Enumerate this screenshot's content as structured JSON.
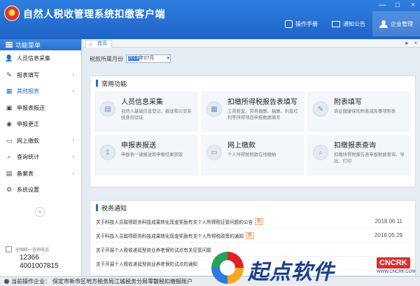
{
  "app": {
    "title": "自然人税收管理系统扣缴客户端",
    "window_controls": [
      "—",
      "□",
      "×"
    ]
  },
  "top_actions": [
    {
      "label": "操作手册",
      "icon": "manual-icon"
    },
    {
      "label": "通知公告",
      "icon": "mail-icon"
    },
    {
      "label": "企业管理",
      "icon": "user-icon"
    }
  ],
  "sidebar": {
    "header": "功能菜单",
    "items": [
      {
        "label": "人员信息采集",
        "icon": "person-icon",
        "chevron": ""
      },
      {
        "label": "报表填写",
        "icon": "edit-icon",
        "chevron": "›"
      },
      {
        "label": "其他报表",
        "icon": "grid-icon",
        "chevron": "›"
      },
      {
        "label": "申报表报送",
        "icon": "send-icon",
        "chevron": ""
      },
      {
        "label": "申报更正",
        "icon": "correct-icon",
        "chevron": ""
      },
      {
        "label": "网上缴款",
        "icon": "pay-icon",
        "chevron": "›"
      },
      {
        "label": "查询统计",
        "icon": "search-icon",
        "chevron": "›"
      },
      {
        "label": "备案表",
        "icon": "file-icon",
        "chevron": "›"
      },
      {
        "label": "系统设置",
        "icon": "gear-icon",
        "chevron": ""
      }
    ],
    "collapse": "«",
    "hotline_title": "全国统一咨询电话",
    "hotline_numbers": [
      "12366",
      "4001007815"
    ]
  },
  "tabbar": {
    "home_tab": "首页",
    "controls": [
      "▸",
      "×"
    ]
  },
  "period": {
    "label": "税款所属月份",
    "value_selected": "2018",
    "value_rest": "年07月"
  },
  "common": {
    "title": "常用功能",
    "cards": [
      {
        "name": "人员信息采集",
        "desc": "自然人基础信息登记、报送和公安系统身份验证",
        "icon": "id-card-icon"
      },
      {
        "name": "扣缴所得税报告表填写",
        "desc": "工资薪金、劳务报酬、稿酬、利息红利等所得项目申报数据填写",
        "icon": "form-icon"
      },
      {
        "name": "附表填写",
        "desc": "商业健康保险附表减免事项附表",
        "icon": "attachment-icon"
      },
      {
        "name": "申报表报送",
        "desc": "申报表一键报送和申报结果获取",
        "icon": "upload-icon"
      },
      {
        "name": "网上缴款",
        "desc": "个人所得税税款在线缴纳",
        "icon": "payment-icon"
      },
      {
        "name": "扣缴报表查询",
        "desc": "扣缴所得税报告表申报数据查询、导出、打印",
        "icon": "query-icon"
      }
    ]
  },
  "notices": {
    "title": "税务通知",
    "new_label": "新",
    "items": [
      {
        "text": "关于科技人员取得职务科技成果转化现金奖励有关个人所得税征管问题的公告",
        "date": "2018.06.11",
        "is_new": true
      },
      {
        "text": "关于科技人员取得职务科技成果转化现金奖励有关个人所得税政策的通知",
        "date": "2018.05.29",
        "is_new": true
      },
      {
        "text": "关于开展个人税收递延型商业养老保险试点有关征管问题",
        "date": "",
        "is_new": false
      },
      {
        "text": "关于开展个人税收递延型商业养老保险试点的通知",
        "date": "",
        "is_new": false
      }
    ]
  },
  "status": {
    "label": "当前操作企业：",
    "value": "保定市新市区地方税务局江城税务分局零散税扣缴报账户"
  },
  "watermark": {
    "text": "起点软件",
    "badge": "CNCRK",
    "url": "WWW.CNCRK.COM"
  },
  "colors": {
    "brand": "#1f63c6",
    "accent": "#1f6fd6",
    "new_badge": "#e2712a"
  }
}
